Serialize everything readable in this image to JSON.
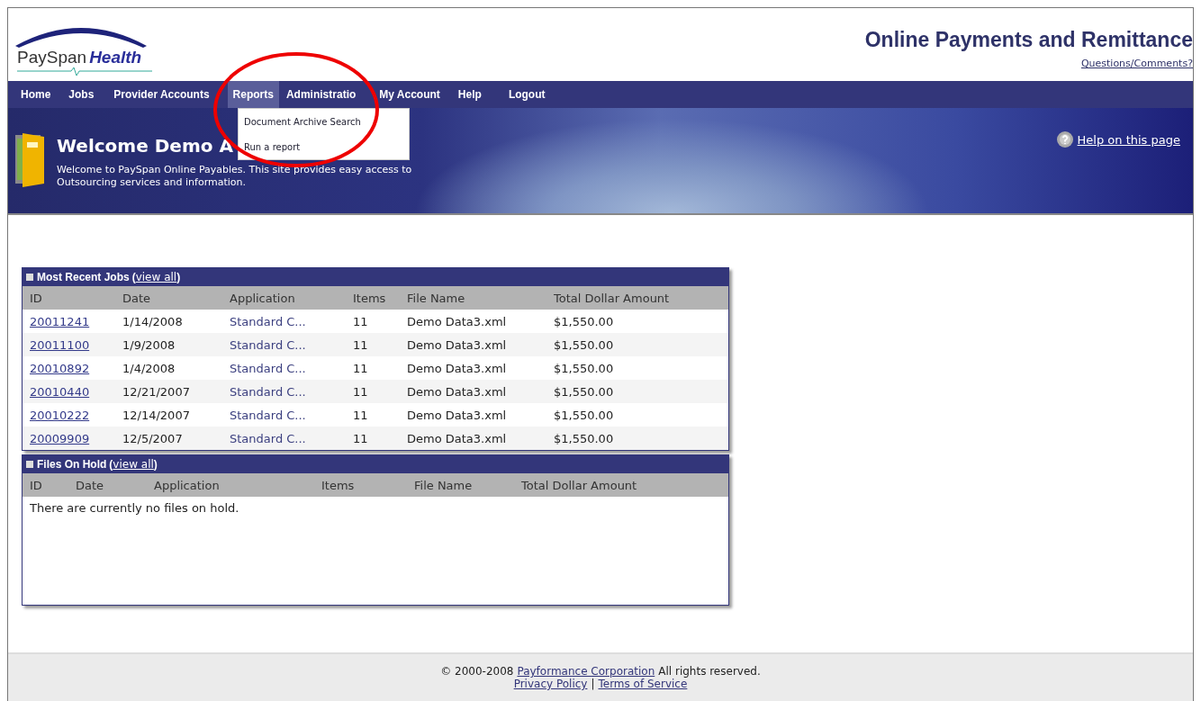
{
  "header": {
    "logo": {
      "brand": "PaySpan",
      "accent": "Health"
    },
    "title": "Online Payments and Remittance",
    "link": "Questions/Comments?"
  },
  "nav": {
    "items": [
      {
        "label": "Home",
        "selected": false
      },
      {
        "label": "Jobs",
        "selected": false
      },
      {
        "label": "Provider Accounts",
        "selected": false
      },
      {
        "label": "Reports",
        "selected": true
      },
      {
        "label": "Administratio",
        "selected": false
      },
      {
        "label": "My Account",
        "selected": false
      },
      {
        "label": "Help",
        "selected": false
      },
      {
        "label": "Logout",
        "selected": false
      }
    ],
    "dropdown": [
      "Document Archive Search",
      "Run a report"
    ]
  },
  "banner": {
    "heading": "Welcome Demo A",
    "text": "Welcome to PaySpan Online Payables. This site provides easy access to Outsourcing services and information.",
    "help": "Help on this page"
  },
  "panels": [
    {
      "title": "Most Recent Jobs",
      "paren_open": "(",
      "link": "view all",
      "paren_close": ")",
      "columns": [
        "ID",
        "Date",
        "Application",
        "Items",
        "File Name",
        "Total Dollar Amount"
      ],
      "rows": [
        [
          "20011241",
          "1/14/2008",
          "Standard C...",
          "11",
          "Demo Data3.xml",
          "$1,550.00"
        ],
        [
          "20011100",
          "1/9/2008",
          "Standard C...",
          "11",
          "Demo Data3.xml",
          "$1,550.00"
        ],
        [
          "20010892",
          "1/4/2008",
          "Standard C...",
          "11",
          "Demo Data3.xml",
          "$1,550.00"
        ],
        [
          "20010440",
          "12/21/2007",
          "Standard C...",
          "11",
          "Demo Data3.xml",
          "$1,550.00"
        ],
        [
          "20010222",
          "12/14/2007",
          "Standard C...",
          "11",
          "Demo Data3.xml",
          "$1,550.00"
        ],
        [
          "20009909",
          "12/5/2007",
          "Standard C...",
          "11",
          "Demo Data3.xml",
          "$1,550.00"
        ]
      ]
    },
    {
      "title": "Files On Hold",
      "paren_open": "(",
      "link": "view all",
      "paren_close": ")",
      "columns": [
        "ID",
        "Date",
        "Application",
        "Items",
        "File Name",
        "Total Dollar Amount"
      ],
      "empty_message": "There are currently no files on hold."
    }
  ],
  "footer": {
    "copyright": "© 2000-2008",
    "company": "Payformance Corporation",
    "rights": "All rights reserved.",
    "links": [
      "Privacy Policy",
      "Terms of Service"
    ],
    "separator": "|"
  }
}
